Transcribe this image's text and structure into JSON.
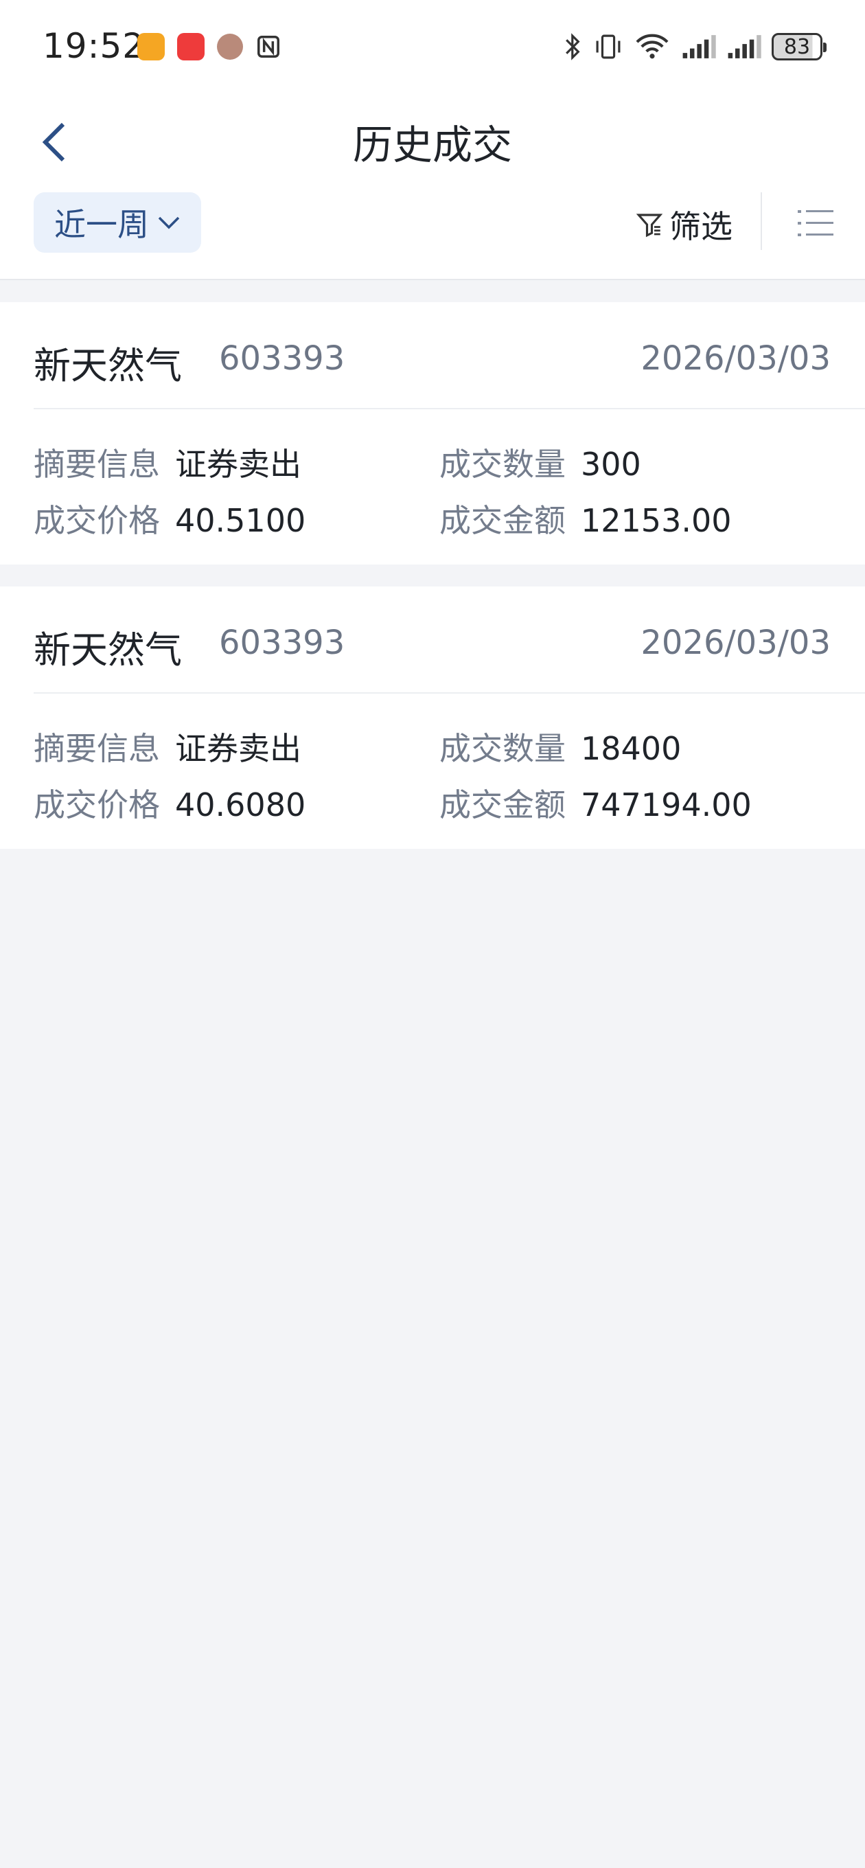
{
  "status_bar": {
    "time": "19:52",
    "battery": "83",
    "app_icons": [
      "app-orange-icon",
      "huawei-appgallery-icon",
      "avatar-icon",
      "nfc-icon"
    ],
    "system_icons": [
      "bluetooth-icon",
      "vibrate-icon",
      "wifi-icon",
      "signal-icon",
      "signal-icon"
    ]
  },
  "nav": {
    "title": "历史成交",
    "back_icon": "chevron-left-icon"
  },
  "filters": {
    "period_label": "近一周",
    "filter_label": "筛选",
    "filter_icon": "funnel-icon",
    "list_icon": "list-icon"
  },
  "trades": [
    {
      "name": "新天然气",
      "code": "603393",
      "date": "2026/03/03",
      "summary_label": "摘要信息",
      "summary": "证券卖出",
      "qty_label": "成交数量",
      "qty": "300",
      "price_label": "成交价格",
      "price": "40.5100",
      "amount_label": "成交金额",
      "amount": "12153.00"
    },
    {
      "name": "新天然气",
      "code": "603393",
      "date": "2026/03/03",
      "summary_label": "摘要信息",
      "summary": "证券卖出",
      "qty_label": "成交数量",
      "qty": "18400",
      "price_label": "成交价格",
      "price": "40.6080",
      "amount_label": "成交金额",
      "amount": "747194.00"
    }
  ],
  "colors": {
    "accent": "#2c4f86",
    "chip_bg": "#eaf1fb",
    "page_bg": "#f3f4f7",
    "label_gray": "#737c8c"
  }
}
